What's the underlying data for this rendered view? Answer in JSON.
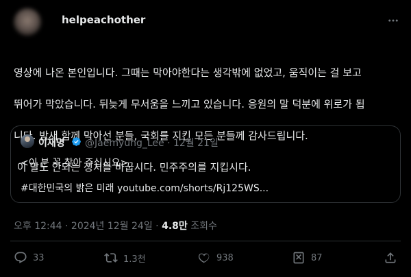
{
  "post": {
    "handle": "helpeachother",
    "text_line1": "영상에 나온 본인입니다. 그때는 막아야한다는 생각밖에 없었고, 움직이는 걸 보고",
    "text_line2": "뛰어가 막았습니다. 뒤늦게 무서움을 느끼고 있습니다. 응원의 말 덕분에 위로가 됩",
    "text_line3": "니다. 밤새 함께 막아선 분들, 국회를 지킨 모든 분들께 감사드립니다.",
    "text_line4": " 이 말도 안되는 정치를 바꿉시다. 민주주의를 지킵시다.",
    "time": "오후 12:44",
    "sep": " · ",
    "date": "2024년 12월 24일",
    "views_count": "4.8만",
    "views_label": "조회수"
  },
  "quoted": {
    "name": "이재명",
    "meta": "@Jaemyung_Lee · 12월 21일",
    "line1": "<이 분 꼭 찾아 주십시요>",
    "line2": "#대한민국의 밝은 미래 youtube.com/shorts/Rj125WS..."
  },
  "actions": {
    "replies": "33",
    "reposts": "1.3천",
    "likes": "938",
    "views": "87",
    "icons": [
      "reply-icon",
      "repost-icon",
      "like-icon",
      "views-icon",
      "share-icon"
    ]
  },
  "colors": {
    "background": "#000000",
    "text": "#e7e9ea",
    "muted": "#71767b",
    "border": "#2f3336",
    "verified": "#1d9bf0"
  }
}
